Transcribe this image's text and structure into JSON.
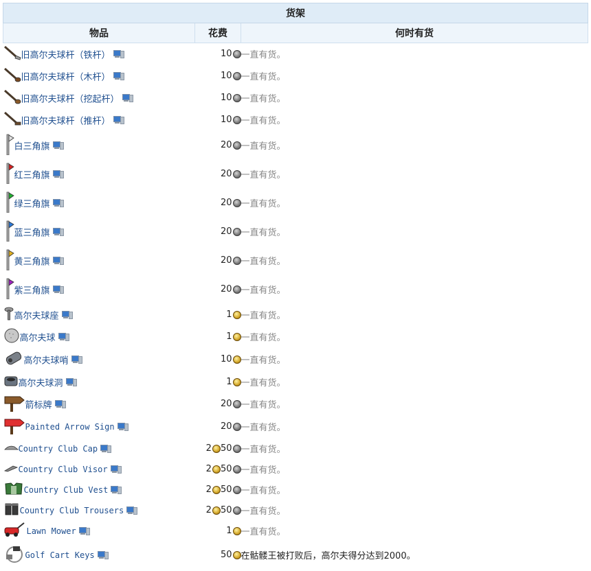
{
  "table": {
    "caption": "货架",
    "headers": {
      "item": "物品",
      "cost": "花费",
      "availability": "何时有货"
    },
    "rows": [
      {
        "icon": "iron-golf-club-icon",
        "name": "旧高尔夫球杆（铁杆）",
        "mono": false,
        "cost": [
          {
            "amount": "10",
            "coin": "silver"
          }
        ],
        "availability": "一直有货。",
        "muted": true
      },
      {
        "icon": "wooden-golf-club-icon",
        "name": "旧高尔夫球杆（木杆）",
        "mono": false,
        "cost": [
          {
            "amount": "10",
            "coin": "silver"
          }
        ],
        "availability": "一直有货。",
        "muted": true
      },
      {
        "icon": "wedge-golf-club-icon",
        "name": "旧高尔夫球杆（挖起杆）",
        "mono": false,
        "cost": [
          {
            "amount": "10",
            "coin": "silver"
          }
        ],
        "availability": "一直有货。",
        "muted": true
      },
      {
        "icon": "putter-golf-club-icon",
        "name": "旧高尔夫球杆（推杆）",
        "mono": false,
        "cost": [
          {
            "amount": "10",
            "coin": "silver"
          }
        ],
        "availability": "一直有货。",
        "muted": true
      },
      {
        "icon": "white-pennant-icon",
        "name": "白三角旗",
        "mono": false,
        "cost": [
          {
            "amount": "20",
            "coin": "silver"
          }
        ],
        "availability": "一直有货。",
        "muted": true
      },
      {
        "icon": "red-pennant-icon",
        "name": "红三角旗",
        "mono": false,
        "cost": [
          {
            "amount": "20",
            "coin": "silver"
          }
        ],
        "availability": "一直有货。",
        "muted": true
      },
      {
        "icon": "green-pennant-icon",
        "name": "绿三角旗",
        "mono": false,
        "cost": [
          {
            "amount": "20",
            "coin": "silver"
          }
        ],
        "availability": "一直有货。",
        "muted": true
      },
      {
        "icon": "blue-pennant-icon",
        "name": "蓝三角旗",
        "mono": false,
        "cost": [
          {
            "amount": "20",
            "coin": "silver"
          }
        ],
        "availability": "一直有货。",
        "muted": true
      },
      {
        "icon": "yellow-pennant-icon",
        "name": "黄三角旗",
        "mono": false,
        "cost": [
          {
            "amount": "20",
            "coin": "silver"
          }
        ],
        "availability": "一直有货。",
        "muted": true
      },
      {
        "icon": "purple-pennant-icon",
        "name": "紫三角旗",
        "mono": false,
        "cost": [
          {
            "amount": "20",
            "coin": "silver"
          }
        ],
        "availability": "一直有货。",
        "muted": true
      },
      {
        "icon": "golf-tee-icon",
        "name": "高尔夫球座",
        "mono": false,
        "cost": [
          {
            "amount": "1",
            "coin": "gold"
          }
        ],
        "availability": "一直有货。",
        "muted": true
      },
      {
        "icon": "golf-ball-icon",
        "name": "高尔夫球",
        "mono": false,
        "cost": [
          {
            "amount": "1",
            "coin": "gold"
          }
        ],
        "availability": "一直有货。",
        "muted": true
      },
      {
        "icon": "golf-whistle-icon",
        "name": "高尔夫球哨",
        "mono": false,
        "cost": [
          {
            "amount": "10",
            "coin": "gold"
          }
        ],
        "availability": "一直有货。",
        "muted": true
      },
      {
        "icon": "golf-cup-icon",
        "name": "高尔夫球洞",
        "mono": false,
        "cost": [
          {
            "amount": "1",
            "coin": "gold"
          }
        ],
        "availability": "一直有货。",
        "muted": true
      },
      {
        "icon": "arrow-sign-icon",
        "name": "箭标牌",
        "mono": false,
        "cost": [
          {
            "amount": "20",
            "coin": "silver"
          }
        ],
        "availability": "一直有货。",
        "muted": true
      },
      {
        "icon": "painted-arrow-sign-icon",
        "name": "Painted Arrow Sign",
        "mono": true,
        "cost": [
          {
            "amount": "20",
            "coin": "silver"
          }
        ],
        "availability": "一直有货。",
        "muted": true
      },
      {
        "icon": "country-club-cap-icon",
        "name": "Country Club Cap",
        "mono": true,
        "cost": [
          {
            "amount": "2",
            "coin": "gold"
          },
          {
            "amount": "50",
            "coin": "silver"
          }
        ],
        "availability": "一直有货。",
        "muted": true
      },
      {
        "icon": "country-club-visor-icon",
        "name": "Country Club Visor",
        "mono": true,
        "cost": [
          {
            "amount": "2",
            "coin": "gold"
          },
          {
            "amount": "50",
            "coin": "silver"
          }
        ],
        "availability": "一直有货。",
        "muted": true
      },
      {
        "icon": "country-club-vest-icon",
        "name": "Country Club Vest",
        "mono": true,
        "cost": [
          {
            "amount": "2",
            "coin": "gold"
          },
          {
            "amount": "50",
            "coin": "silver"
          }
        ],
        "availability": "一直有货。",
        "muted": true
      },
      {
        "icon": "country-club-trousers-icon",
        "name": "Country Club Trousers",
        "mono": true,
        "cost": [
          {
            "amount": "2",
            "coin": "gold"
          },
          {
            "amount": "50",
            "coin": "silver"
          }
        ],
        "availability": "一直有货。",
        "muted": true
      },
      {
        "icon": "lawn-mower-icon",
        "name": "Lawn Mower",
        "mono": true,
        "cost": [
          {
            "amount": "1",
            "coin": "gold"
          }
        ],
        "availability": "一直有货。",
        "muted": true
      },
      {
        "icon": "golf-cart-keys-icon",
        "name": "Golf Cart Keys",
        "mono": true,
        "cost": [
          {
            "amount": "50",
            "coin": "gold"
          }
        ],
        "availability": "在骷髅王被打败后，高尔夫得分达到2000。",
        "muted": false
      }
    ]
  },
  "colors": {
    "link": "#1f4f8f",
    "caption_bg": "#dfecf7",
    "header_bg": "#eef5fb",
    "muted_text": "#888888"
  }
}
